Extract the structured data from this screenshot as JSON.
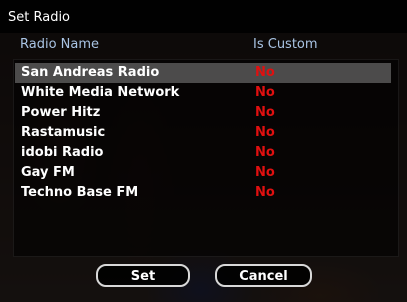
{
  "dialog": {
    "title": "Set Radio",
    "columns": {
      "name": "Radio Name",
      "custom": "Is Custom"
    },
    "rows": [
      {
        "name": "San Andreas Radio",
        "custom": "No",
        "selected": true
      },
      {
        "name": "White Media Network",
        "custom": "No"
      },
      {
        "name": "Power Hitz",
        "custom": "No"
      },
      {
        "name": "Rastamusic",
        "custom": "No"
      },
      {
        "name": "idobi Radio",
        "custom": "No"
      },
      {
        "name": "Gay FM",
        "custom": "No"
      },
      {
        "name": "Techno Base FM",
        "custom": "No"
      }
    ],
    "buttons": {
      "set": "Set",
      "cancel": "Cancel"
    },
    "colors": {
      "header_text": "#a9c4e4",
      "no_text": "#e01010",
      "selected_row": "#878787"
    }
  }
}
